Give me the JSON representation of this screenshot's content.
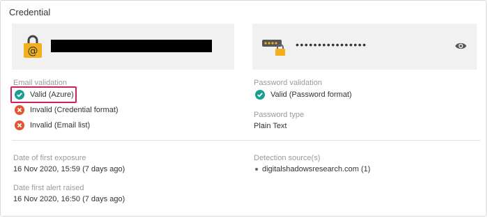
{
  "panel": {
    "title": "Credential"
  },
  "email": {
    "validation_label": "Email validation",
    "items": [
      {
        "status": "valid",
        "text": "Valid (Azure)"
      },
      {
        "status": "invalid",
        "text": "Invalid (Credential format)"
      },
      {
        "status": "invalid",
        "text": "Invalid (Email list)"
      }
    ]
  },
  "password": {
    "masked": "••••••••••••••••",
    "validation_label": "Password validation",
    "validation_text": "Valid (Password format)",
    "type_label": "Password type",
    "type_value": "Plain Text"
  },
  "exposure": {
    "first_exposure_label": "Date of first exposure",
    "first_exposure_value": "16 Nov 2020, 15:59 (7 days ago)",
    "first_alert_label": "Date first alert raised",
    "first_alert_value": "16 Nov 2020, 16:50 (7 days ago)"
  },
  "detection": {
    "label": "Detection source(s)",
    "sources": [
      "digitalshadowsresearch.com (1)"
    ]
  },
  "colors": {
    "valid": "#1a9e8f",
    "invalid": "#e5532f",
    "highlight": "#d81b60",
    "email_icon": "#f2b01e"
  }
}
